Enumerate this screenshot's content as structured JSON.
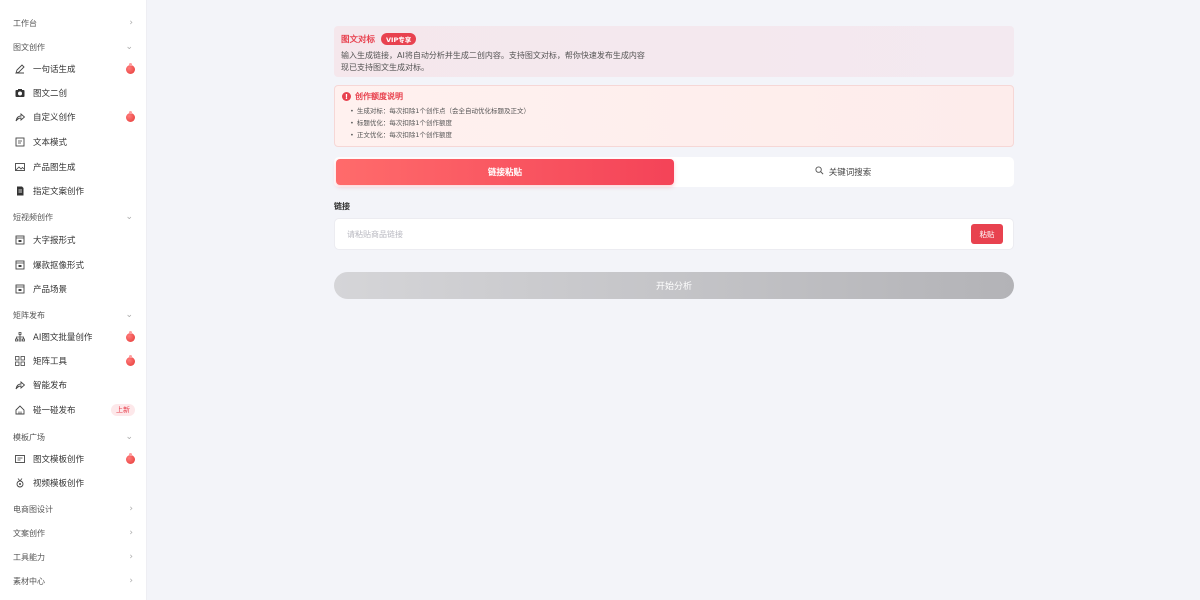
{
  "sidebar": {
    "groups": [
      {
        "label": "工作台"
      },
      {
        "label": "图文创作"
      },
      {
        "label": "短视频创作"
      },
      {
        "label": "矩阵发布"
      },
      {
        "label": "模板广场"
      },
      {
        "label": "电商图设计"
      },
      {
        "label": "文案创作"
      },
      {
        "label": "工具能力"
      },
      {
        "label": "素材中心"
      }
    ],
    "items": [
      {
        "label": "一句话生成",
        "icon": "pencil-icon",
        "hot": true
      },
      {
        "label": "图文二创",
        "icon": "camera-icon",
        "hot": false
      },
      {
        "label": "自定义创作",
        "icon": "share-icon",
        "hot": true
      },
      {
        "label": "文本模式",
        "icon": "document-icon",
        "hot": false
      },
      {
        "label": "产品图生成",
        "icon": "image-icon",
        "hot": false
      },
      {
        "label": "指定文案创作",
        "icon": "file-icon",
        "hot": false
      },
      {
        "label": "大字报形式",
        "icon": "video-icon",
        "hot": false
      },
      {
        "label": "爆款抠像形式",
        "icon": "video-icon",
        "hot": false
      },
      {
        "label": "产品场景",
        "icon": "video-icon",
        "hot": false
      },
      {
        "label": "AI图文批量创作",
        "icon": "sitemap-icon",
        "hot": true
      },
      {
        "label": "矩阵工具",
        "icon": "grid-icon",
        "hot": true
      },
      {
        "label": "智能发布",
        "icon": "share-icon",
        "hot": false
      },
      {
        "label": "碰一碰发布",
        "icon": "home-icon",
        "badge": "上新"
      },
      {
        "label": "图文模板创作",
        "icon": "template-icon",
        "hot": true
      },
      {
        "label": "视频模板创作",
        "icon": "medal-icon",
        "hot": false
      }
    ]
  },
  "vip_card": {
    "title": "图文对标",
    "badge": "VIP专享",
    "desc_line1": "输入生成链接，AI将自动分析并生成二创内容。支持图文对标，帮你快速发布生成内容",
    "desc_line2": "现已支持图文生成对标。"
  },
  "quota_card": {
    "title": "创作额度说明",
    "items": [
      "生成对标：每次扣除1个创作点（会全自动优化标题及正文）",
      "标题优化：每次扣除1个创作额度",
      "正文优化：每次扣除1个创作额度"
    ]
  },
  "tabs": [
    {
      "label": "链接粘贴",
      "active": true
    },
    {
      "label": "关键词搜索",
      "active": false
    }
  ],
  "link_field": {
    "label": "链接",
    "placeholder": "请粘贴商品链接",
    "paste_button": "粘贴"
  },
  "analyze_button": "开始分析",
  "colors": {
    "accent": "#e8424f",
    "tab_gradient_start": "#ff6b6b",
    "tab_gradient_end": "#f44358",
    "disabled_button": "#c4c4c8"
  }
}
